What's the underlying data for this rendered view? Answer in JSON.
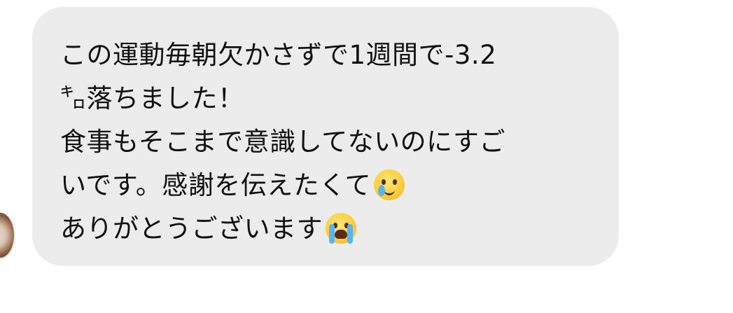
{
  "message": {
    "lines": [
      "この運動毎朝欠かさずで1週間で-3.2",
      "㌔落ちました！",
      "食事もそこまで意識してないのにすご",
      "いです。感謝を伝えたくて",
      "ありがとうございます"
    ],
    "emojis": [
      "smiling-face-with-tear",
      "loudly-crying-face"
    ],
    "bubble_color": "#ececec",
    "text_color": "#111111"
  }
}
